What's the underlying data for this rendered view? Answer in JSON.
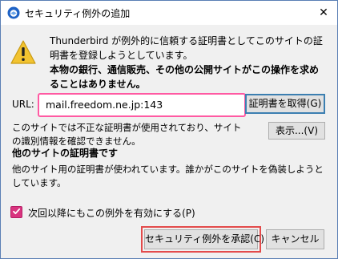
{
  "window": {
    "title": "セキュリティ例外の追加",
    "close_symbol": "✕",
    "app_icon": "thunderbird-icon"
  },
  "message": {
    "icon": "warning-icon",
    "text": "Thunderbird が例外的に信頼する証明書としてこのサイトの証明書を登録しようとしています。",
    "bold": "本物の銀行、通信販売、その他の公開サイトがこの操作を求めることはありません。"
  },
  "location": {
    "label": "URL:",
    "value": "mail.freedom.ne.jp:143",
    "get_button": "証明書を取得(G)"
  },
  "status": {
    "text": "このサイトでは不正な証明書が使用されており、サイトの識別情報を確認できません。",
    "view_button": "表示...(V)"
  },
  "section": {
    "title": "他のサイトの証明書です",
    "description": "他のサイト用の証明書が使われています。誰かがこのサイトを偽装しようとしています。"
  },
  "permanent": {
    "label": "次回以降にもこの例外を有効にする(P)",
    "checked": true
  },
  "buttons": {
    "confirm": "セキュリティ例外を承認(C)",
    "cancel": "キャンセル"
  },
  "colors": {
    "url_border": "#ff5aa3",
    "checkbox": "#d9347f",
    "focus_outline": "#e34b4b",
    "warning": "#f2c330"
  }
}
